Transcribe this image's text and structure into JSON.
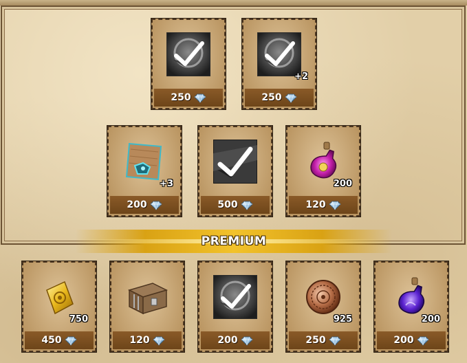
{
  "banner": {
    "label": "PREMIUM"
  },
  "regular_items": [
    {
      "icon": "skip-check-icon",
      "qty": "",
      "price": "250"
    },
    {
      "icon": "skip-check-icon",
      "qty": "+2",
      "price": "250"
    },
    {
      "icon": "blueprint-scroll-icon",
      "qty": "+3",
      "price": "200"
    },
    {
      "icon": "large-skip-check-icon",
      "qty": "",
      "price": "500"
    },
    {
      "icon": "magenta-potion-icon",
      "qty": "200",
      "price": "120"
    }
  ],
  "premium_items": [
    {
      "icon": "gold-bar-icon",
      "qty": "750",
      "price": "450"
    },
    {
      "icon": "treasure-chest-icon",
      "qty": "",
      "price": "120"
    },
    {
      "icon": "skip-check-icon",
      "qty": "",
      "price": "200"
    },
    {
      "icon": "bronze-coin-icon",
      "qty": "925",
      "price": "250"
    },
    {
      "icon": "purple-potion-icon",
      "qty": "200",
      "price": "200"
    }
  ],
  "colors": {
    "price_bar": "#7a4f22",
    "banner_gold": "#f2c22b",
    "parchment": "#e2cfa8"
  }
}
